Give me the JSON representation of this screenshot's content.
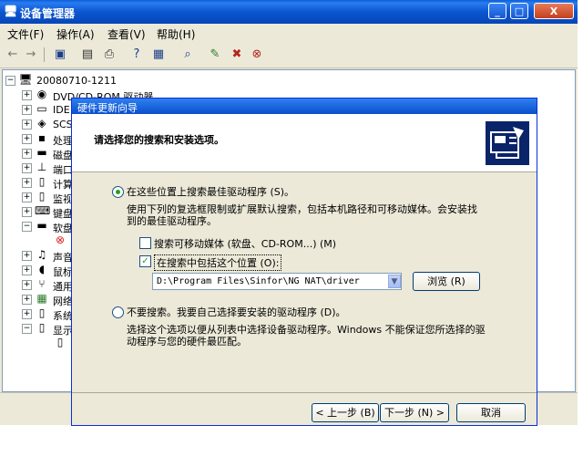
{
  "device_manager": {
    "title": "设备管理器",
    "window_controls": {
      "minimize": "_",
      "maximize": "□",
      "close": "X"
    },
    "menu": [
      "文件(F)",
      "操作(A)",
      "查看(V)",
      "帮助(H)"
    ],
    "tree": {
      "root": "20080710-1211",
      "items": [
        "DVD/CD-ROM 驱动器",
        "IDE",
        "SCS",
        "处理",
        "磁盘",
        "端口",
        "计算",
        "监视",
        "键盘",
        "软盘",
        "",
        "声音",
        "鼠标",
        "通用",
        "网络",
        "系统",
        "显示",
        ""
      ]
    }
  },
  "wizard": {
    "title": "硬件更新向导",
    "heading": "请选择您的搜索和安装选项。",
    "option_search": {
      "label": "在这些位置上搜索最佳驱动程序 (S)。",
      "description_line1": "使用下列的复选框限制或扩展默认搜索，包括本机路径和可移动媒体。会安装找",
      "description_line2": "到的最佳驱动程序。"
    },
    "check_removable": {
      "label": "搜索可移动媒体 (软盘、CD-ROM...) (M)"
    },
    "check_location": {
      "label": "在搜索中包括这个位置 (O):"
    },
    "path_value": "D:\\Program Files\\Sinfor\\NG NAT\\driver",
    "browse_label": "浏览 (R)",
    "option_manual": {
      "label": "不要搜索。我要自己选择要安装的驱动程序 (D)。",
      "description_line1": "选择这个选项以便从列表中选择设备驱动程序。Windows 不能保证您所选择的驱",
      "description_line2": "动程序与您的硬件最匹配。"
    },
    "back_label": "< 上一步 (B)",
    "next_label": "下一步 (N) >",
    "cancel_label": "取消"
  }
}
